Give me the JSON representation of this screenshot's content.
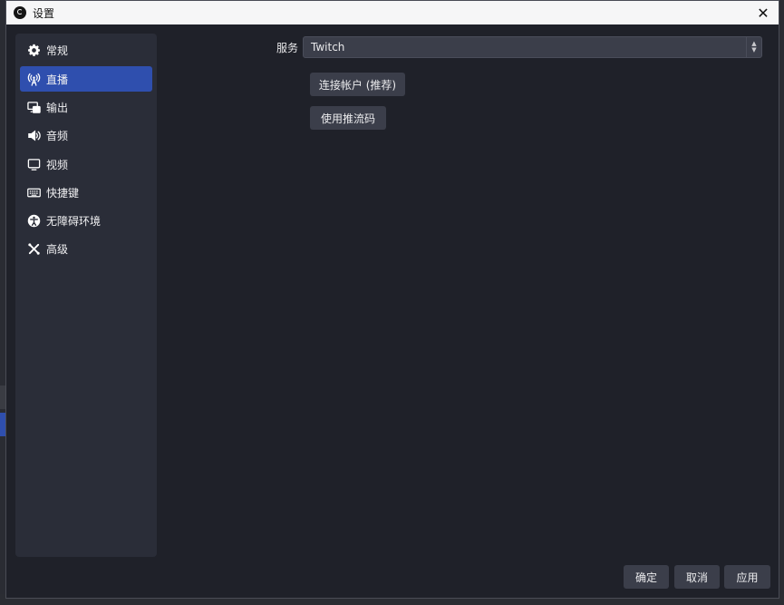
{
  "window": {
    "title": "设置",
    "close_glyph": "✕"
  },
  "sidebar": {
    "items": [
      {
        "label": "常规",
        "icon": "gear-icon",
        "active": false
      },
      {
        "label": "直播",
        "icon": "antenna-icon",
        "active": true
      },
      {
        "label": "输出",
        "icon": "output-icon",
        "active": false
      },
      {
        "label": "音频",
        "icon": "speaker-icon",
        "active": false
      },
      {
        "label": "视频",
        "icon": "monitor-icon",
        "active": false
      },
      {
        "label": "快捷键",
        "icon": "keyboard-icon",
        "active": false
      },
      {
        "label": "无障碍环境",
        "icon": "accessibility-icon",
        "active": false
      },
      {
        "label": "高级",
        "icon": "tools-icon",
        "active": false
      }
    ]
  },
  "stream": {
    "service_label": "服务",
    "service_value": "Twitch",
    "connect_account_label": "连接帐户 (推荐)",
    "use_stream_key_label": "使用推流码"
  },
  "footer": {
    "ok_label": "确定",
    "cancel_label": "取消",
    "apply_label": "应用"
  },
  "colors": {
    "accent": "#2f4fae",
    "window_bg": "#1f2129",
    "sidebar_bg": "#2a2d38",
    "button_bg": "#3b3e4a"
  }
}
